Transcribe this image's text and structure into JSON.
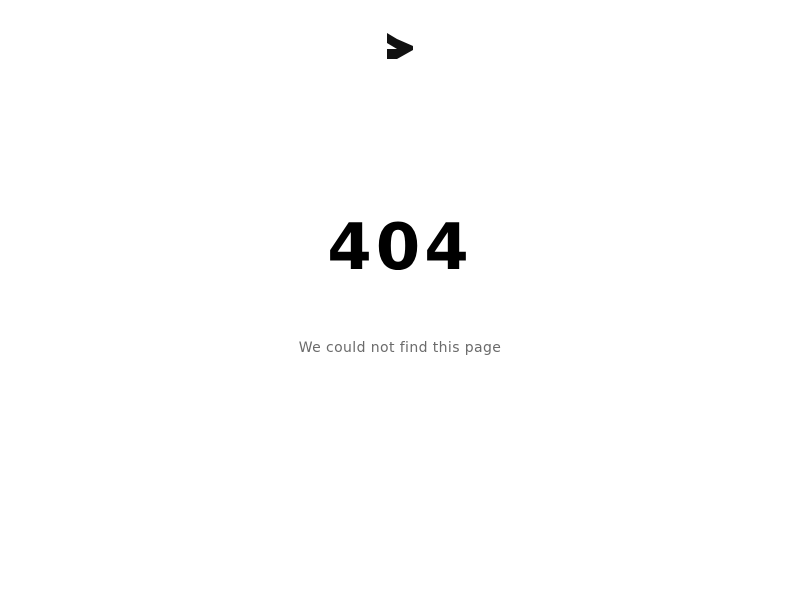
{
  "header": {
    "logo_icon": "brand-logo-icon"
  },
  "main": {
    "error_code": "404",
    "message": "We could not find this page"
  },
  "colors": {
    "background": "#ffffff",
    "heading": "#000000",
    "message": "#6b6b6b",
    "logo": "#111111"
  }
}
